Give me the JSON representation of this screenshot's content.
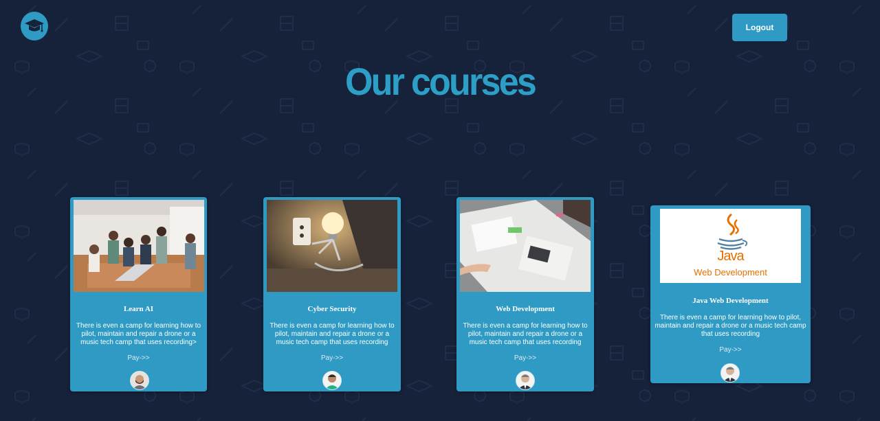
{
  "header": {
    "logo_icon": "graduation-cap-icon",
    "logout_label": "Logout"
  },
  "main": {
    "title": "Our courses"
  },
  "courses": [
    {
      "title": "Learn AI",
      "description": "There is even a camp for learning how to pilot, maintain and repair a drone or a music tech camp that uses recording>",
      "link": "Pay->>",
      "image": "classroom-photo",
      "avatar": "bearded-man-avatar"
    },
    {
      "title": "Cyber Security",
      "description": "There is even a camp for learning how to pilot, maintain and repair a drone or a music tech camp that uses recording",
      "link": "Pay->>",
      "image": "lightbulb-figure-photo",
      "avatar": "smiling-man-avatar"
    },
    {
      "title": "Web Development",
      "description": "There is even a camp for learning how to pilot, maintain and repair a drone or a music tech camp that uses recording",
      "link": "Pay->>",
      "image": "desk-papers-photo",
      "avatar": "man-in-suit-avatar"
    },
    {
      "title": "Java Web Development",
      "description": "There is even a camp for learning how to pilot, maintain and repair a drone or a music tech camp that uses recording",
      "link": "Pay->>",
      "image": "java-logo-image",
      "image_text_brand": "Java",
      "image_text_caption": "Web Development",
      "avatar": "man-in-suit-avatar"
    }
  ],
  "colors": {
    "background": "#16213a",
    "accent": "#2f9bc4",
    "title": "#2d9fc6",
    "java_orange": "#e76f00",
    "java_blue": "#5382a1"
  }
}
